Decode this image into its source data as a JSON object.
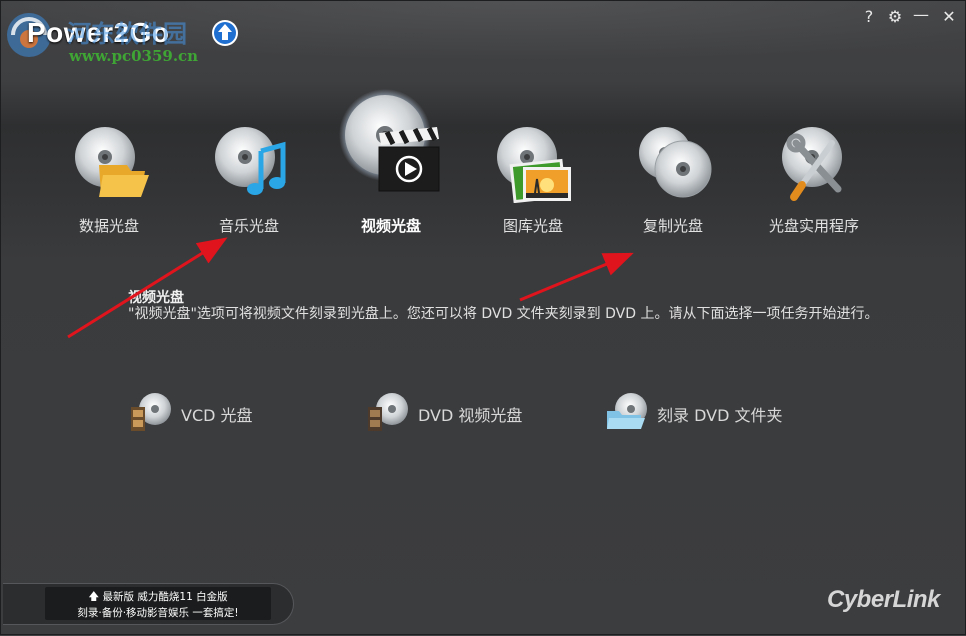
{
  "app": {
    "title": "Power2Go"
  },
  "watermark": {
    "site_name": "河东软件园",
    "url": "www.pc0359.cn"
  },
  "window_controls": {
    "help": "?",
    "settings": "⚙",
    "minimize": "—",
    "close": "✕"
  },
  "tasks": [
    {
      "id": "data",
      "label": "数据光盘"
    },
    {
      "id": "music",
      "label": "音乐光盘"
    },
    {
      "id": "video",
      "label": "视频光盘",
      "selected": true
    },
    {
      "id": "photo",
      "label": "图库光盘"
    },
    {
      "id": "copy",
      "label": "复制光盘"
    },
    {
      "id": "utility",
      "label": "光盘实用程序"
    }
  ],
  "description": {
    "title": "视频光盘",
    "text": "\"视频光盘\"选项可将视频文件刻录到光盘上。您还可以将 DVD 文件夹刻录到 DVD 上。请从下面选择一项任务开始进行。"
  },
  "options": [
    {
      "label": "VCD 光盘"
    },
    {
      "label": "DVD 视频光盘"
    },
    {
      "label": "刻录 DVD 文件夹"
    }
  ],
  "promo": {
    "line1": "最新版 威力酷烧11 白金版",
    "line2": "刻录·备份·移动影音娱乐 一套搞定!"
  },
  "brand": {
    "vendor": "CyberLink"
  },
  "colors": {
    "background": "#3c3d3f",
    "accent_blue": "#1e6fd0",
    "arrow_red": "#e0141c"
  }
}
